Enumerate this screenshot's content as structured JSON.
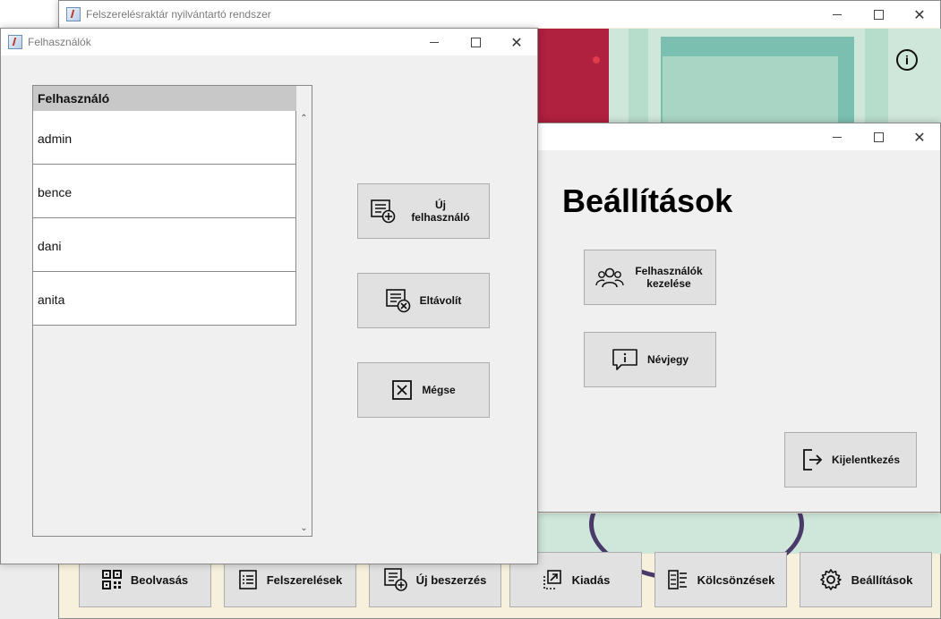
{
  "main_window": {
    "title": "Felszerelésraktár nyilvántartó rendszer",
    "info_icon": "info-circle-icon",
    "bottom_buttons": [
      {
        "label": "Beolvasás",
        "icon": "qr-code-icon"
      },
      {
        "label": "Felszerelések",
        "icon": "list-icon"
      },
      {
        "label": "Új beszerzés",
        "icon": "add-list-icon"
      },
      {
        "label": "Kiadás",
        "icon": "export-icon"
      },
      {
        "label": "Kölcsönzések",
        "icon": "loans-icon"
      },
      {
        "label": "Beállítások",
        "icon": "gear-icon"
      }
    ]
  },
  "settings_window": {
    "heading": "Beállítások",
    "manage_users_label": "Felhasználók kezelése",
    "about_label": "Névjegy",
    "logout_label": "Kijelentkezés"
  },
  "users_window": {
    "title": "Felhasználók",
    "column_header": "Felhasználó",
    "rows": [
      "admin",
      "bence",
      "dani",
      "anita"
    ],
    "new_user_label": "Új felhasználó",
    "remove_label": "Eltávolít",
    "cancel_label": "Mégse"
  },
  "colors": {
    "window_bg": "#f0f0f0",
    "button_bg": "#e1e1e1",
    "table_header_bg": "#c8c8c8",
    "main_bg": "#f6f0dc",
    "teal_accent": "#7bbfb0",
    "crimson_accent": "#b0203f"
  }
}
